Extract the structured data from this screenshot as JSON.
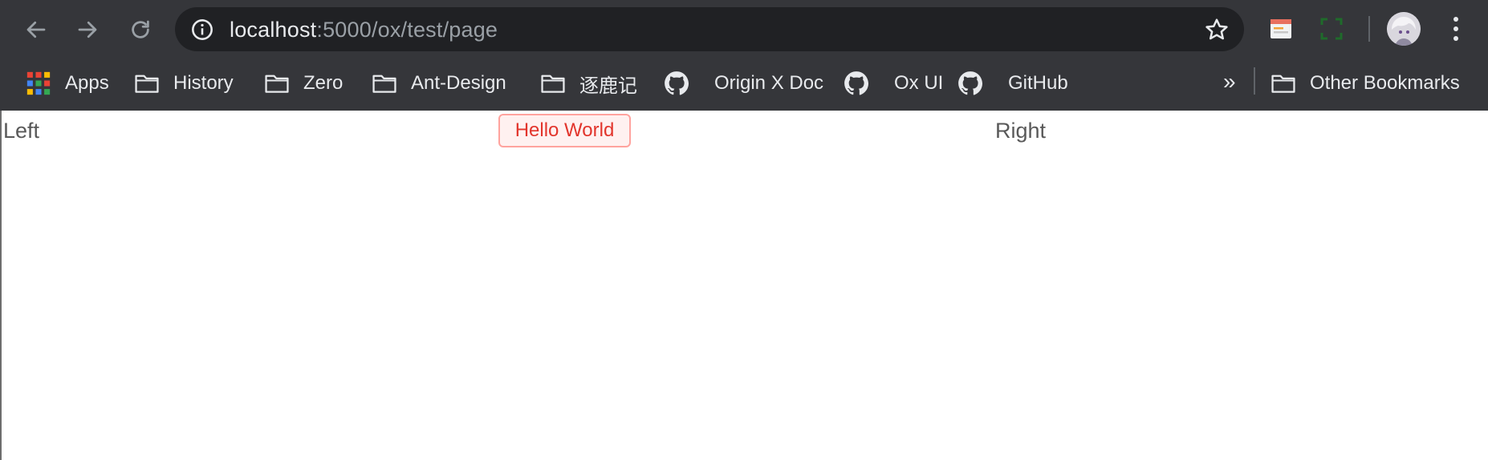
{
  "browser": {
    "url_host": "localhost",
    "url_path": ":5000/ox/test/page",
    "icons": {
      "back": "arrow-left-icon",
      "forward": "arrow-right-icon",
      "reload": "reload-icon",
      "info": "info-icon",
      "bookmark": "star-icon",
      "menu": "kebab-menu-icon"
    }
  },
  "bookmarks": {
    "items": [
      {
        "label": "Apps",
        "icon": "apps-grid-icon"
      },
      {
        "label": "History",
        "icon": "folder-icon"
      },
      {
        "label": "Zero",
        "icon": "folder-icon"
      },
      {
        "label": "Ant-Design",
        "icon": "folder-icon"
      },
      {
        "label": "逐鹿记",
        "icon": "folder-icon"
      },
      {
        "label": "Origin X Doc",
        "icon": "github-icon"
      },
      {
        "label": "Ox UI",
        "icon": "github-icon"
      },
      {
        "label": "GitHub",
        "icon": "github-icon"
      }
    ],
    "overflow": "»",
    "other": "Other Bookmarks"
  },
  "page": {
    "left_text": "Left",
    "button_label": "Hello World",
    "right_text": "Right"
  },
  "colors": {
    "toolbar_bg": "#35363a",
    "omnibox_bg": "#202124",
    "tag_bg": "#fff1f0",
    "tag_border": "#ffa39e",
    "tag_text": "#e2352c"
  }
}
